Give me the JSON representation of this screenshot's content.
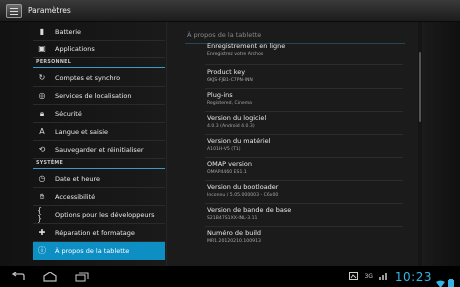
{
  "app": {
    "title": "Paramètres",
    "icon": "settings-icon"
  },
  "sidebar": {
    "items": [
      {
        "label": "Batterie",
        "icon": "battery-icon",
        "type": "item"
      },
      {
        "label": "Applications",
        "icon": "applications-icon",
        "type": "item"
      },
      {
        "label": "PERSONNEL",
        "type": "section"
      },
      {
        "label": "Comptes et synchro",
        "icon": "sync-icon",
        "type": "item"
      },
      {
        "label": "Services de localisation",
        "icon": "location-icon",
        "type": "item"
      },
      {
        "label": "Sécurité",
        "icon": "lock-icon",
        "type": "item"
      },
      {
        "label": "Langue et saisie",
        "icon": "language-icon",
        "type": "item"
      },
      {
        "label": "Sauvegarder et réinitialiser",
        "icon": "backup-icon",
        "type": "item"
      },
      {
        "label": "SYSTÈME",
        "type": "section"
      },
      {
        "label": "Date et heure",
        "icon": "clock-icon",
        "type": "item"
      },
      {
        "label": "Accessibilité",
        "icon": "accessibility-icon",
        "type": "item"
      },
      {
        "label": "Options pour les développeurs",
        "icon": "developer-icon",
        "type": "item"
      },
      {
        "label": "Réparation et formatage",
        "icon": "repair-icon",
        "type": "item"
      },
      {
        "label": "À propos de la tablette",
        "icon": "info-icon",
        "type": "item",
        "selected": true
      }
    ]
  },
  "detail": {
    "header": "À propos de la tablette",
    "rows": [
      {
        "title": "Enregistrement en ligne",
        "subtitle": "Enregistrez votre Archos"
      },
      {
        "title": "Product key",
        "subtitle": "6KJS-FJB1-C7PN-INN"
      },
      {
        "title": "Plug-ins",
        "subtitle": "Registered, Cinema"
      },
      {
        "title": "Version du logiciel",
        "subtitle": "4.0.3 (Android 4.0.3)"
      },
      {
        "title": "Version du matériel",
        "subtitle": "A101H-V5 (T1)"
      },
      {
        "title": "OMAP version",
        "subtitle": "OMAP4460 ES1.1"
      },
      {
        "title": "Version du bootloader",
        "subtitle": "Inconnu / 5.05.000003 - C6x00"
      },
      {
        "title": "Version de bande de base",
        "subtitle": "S21B47S1XX-INL-3.11"
      },
      {
        "title": "Numéro de build",
        "subtitle": "MR1.20120210.100913"
      }
    ]
  },
  "statusbar": {
    "network": "3G",
    "clock": "10:23",
    "nav": [
      "back-icon",
      "home-icon",
      "recent-apps-icon"
    ]
  },
  "colors": {
    "accent": "#0e8fc4",
    "clock": "#33b5e5"
  }
}
